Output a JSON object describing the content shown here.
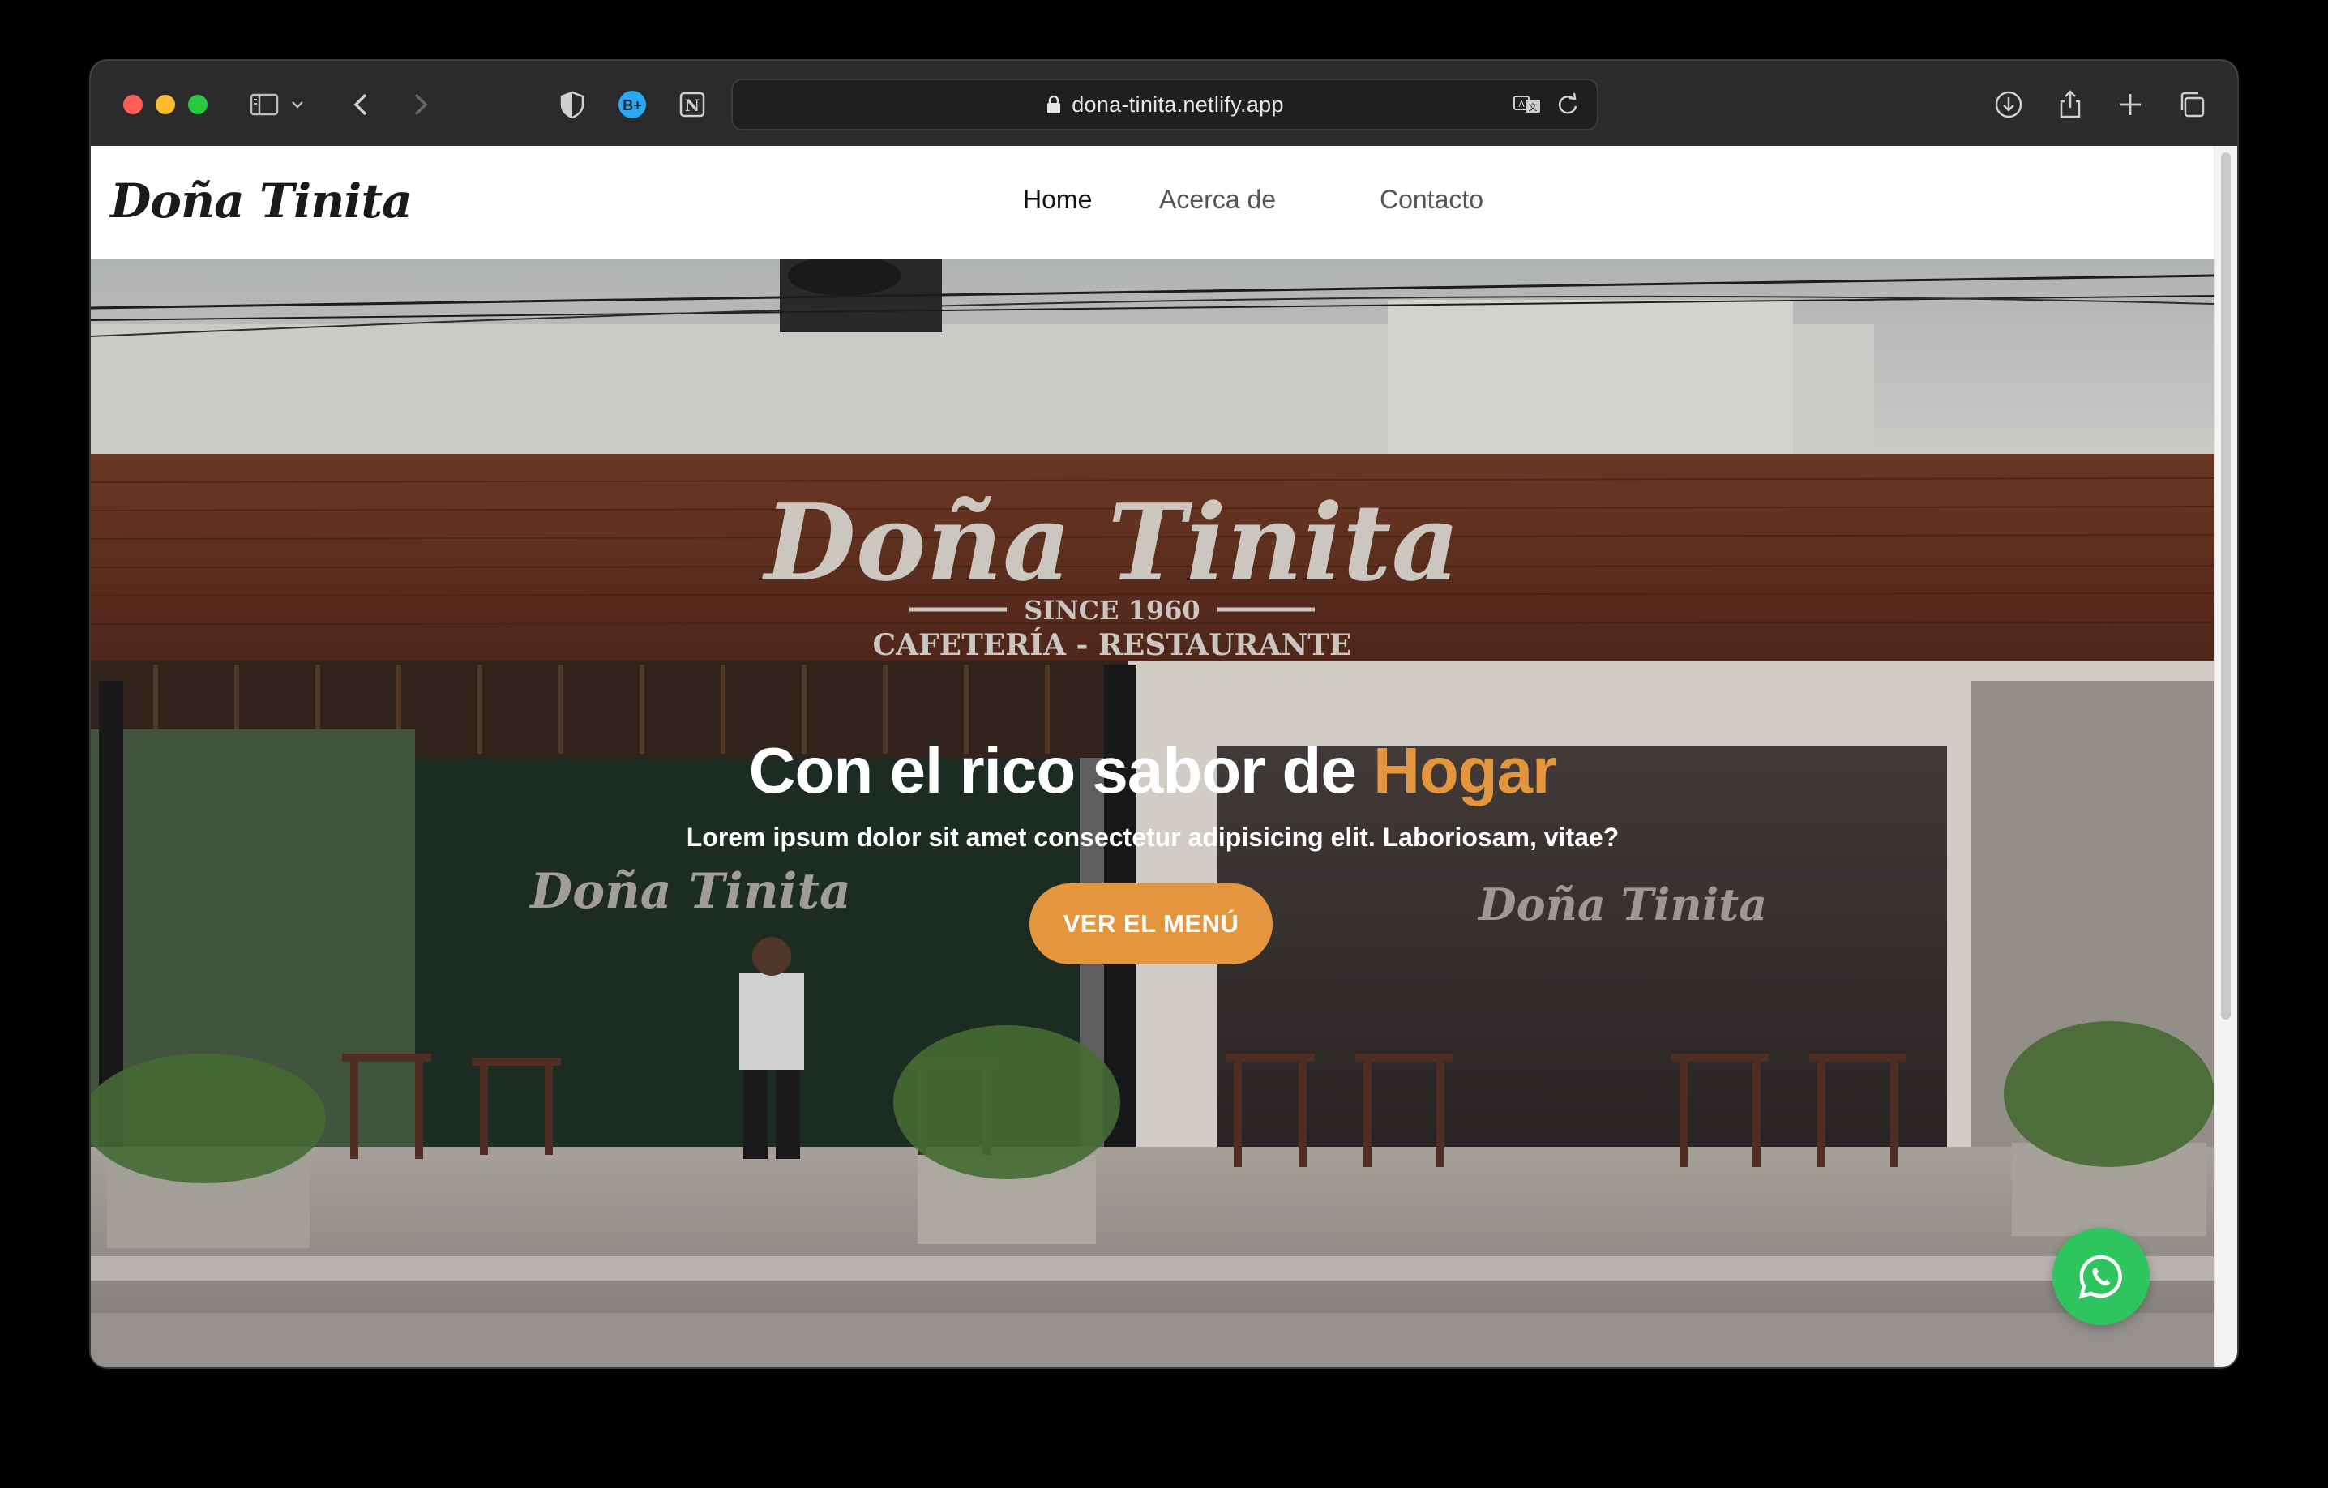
{
  "browser": {
    "url": "dona-tinita.netlify.app",
    "extension_badge": "B+"
  },
  "site": {
    "logo": "Doña Tinita",
    "nav": [
      {
        "label": "Home",
        "active": true
      },
      {
        "label": "Acerca de",
        "active": false
      },
      {
        "label": "Contacto",
        "active": false
      }
    ]
  },
  "storefront_sign": {
    "name": "Doña Tinita",
    "since": "SINCE 1960",
    "tagline": "CAFETERÍA - RESTAURANTE"
  },
  "hero": {
    "title_prefix": "Con el rico sabor de ",
    "title_accent": "Hogar",
    "subtitle": "Lorem ipsum dolor sit amet consectetur adipisicing elit. Laboriosam, vitae?",
    "cta_label": "VER EL MENÚ"
  },
  "colors": {
    "accent": "#e3963e",
    "whatsapp": "#2fc55e",
    "toolbar": "#2b2b2d"
  },
  "icons": [
    "sidebar-icon",
    "chevron-down-icon",
    "back-icon",
    "forward-icon",
    "shield-icon",
    "notion-icon",
    "lock-icon",
    "translate-icon",
    "reload-icon",
    "download-icon",
    "share-icon",
    "new-tab-icon",
    "tabs-overview-icon",
    "whatsapp-icon"
  ]
}
